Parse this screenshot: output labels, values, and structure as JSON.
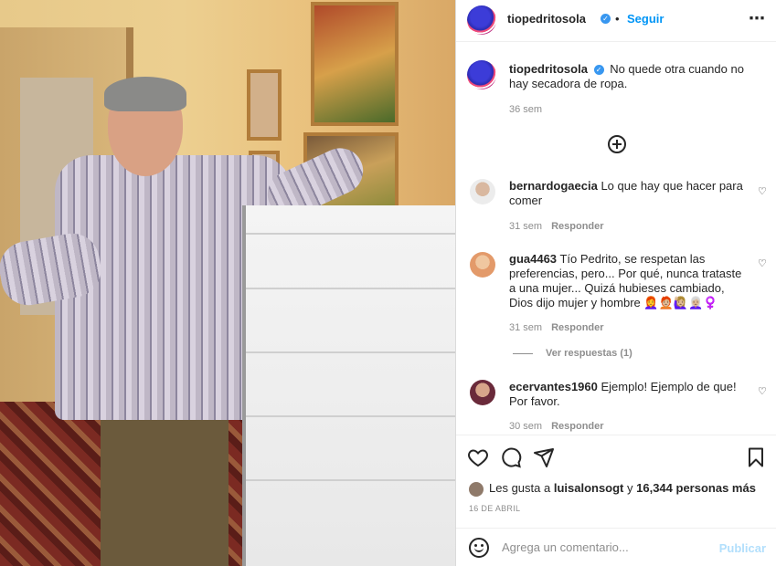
{
  "header": {
    "username": "tiopedritosola",
    "separator": "•",
    "follow_label": "Seguir",
    "more_icon": "more-horizontal-icon"
  },
  "caption": {
    "username": "tiopedritosola",
    "text": "No quede otra cuando no hay secadora de ropa.",
    "time": "36 sem"
  },
  "load_more_icon": "plus-circle-icon",
  "comments": [
    {
      "username": "bernardogaecia",
      "text": "Lo que hay que hacer para comer",
      "time": "31 sem",
      "reply": "Responder"
    },
    {
      "username": "gua4463",
      "text": "Tío Pedrito, se respetan las preferencias, pero... Por qué, nunca trataste a una mujer... Quizá hubieses cambiado, Dios dijo mujer y hombre 👩‍🦰🧑🏼‍🦰🙋🏼‍♀️👩🏼‍🦳♀️",
      "time": "31 sem",
      "reply": "Responder"
    },
    {
      "username": "ecervantes1960",
      "text": "Ejemplo! Ejemplo de que! Por favor.",
      "time": "30 sem",
      "reply": "Responder"
    }
  ],
  "view_replies": "Ver respuestas (1)",
  "actions": {
    "like_icon": "heart-icon",
    "comment_icon": "comment-icon",
    "share_icon": "send-icon",
    "save_icon": "bookmark-icon"
  },
  "likes": {
    "prefix": "Les gusta a ",
    "user": "luisalonsogt",
    "middle": " y ",
    "count": "16,344 personas más"
  },
  "date": "16 DE ABRIL",
  "comment_bar": {
    "emoji_icon": "emoji-icon",
    "placeholder": "Agrega un comentario...",
    "post_label": "Publicar"
  }
}
